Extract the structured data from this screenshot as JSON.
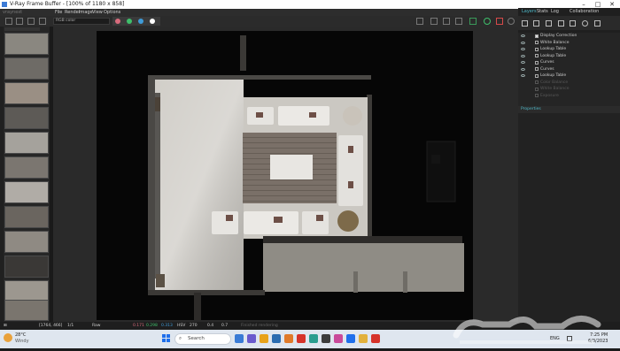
{
  "window": {
    "title": "V-Ray Frame Buffer - [100% of 1180 x 858]",
    "controls": [
      "–",
      "□",
      "✕"
    ]
  },
  "menubar": {
    "brand": "vraynext",
    "items": [
      "File",
      "Render",
      "Image",
      "View",
      "Options"
    ]
  },
  "toolbar": {
    "channel_value": "RGB color",
    "channel_dots": [
      "#d86b7c",
      "#3fbf6b",
      "#3f9bd8",
      "#ffffff"
    ]
  },
  "right_panel": {
    "tabs": [
      "Layers",
      "Stats",
      "Log",
      "Collaboration"
    ],
    "active_tab": "Layers",
    "accent": "#4fb8c8",
    "layers": [
      {
        "label": "Display Correction",
        "visible": true,
        "checked": true
      },
      {
        "label": "White Balance",
        "visible": true
      },
      {
        "label": "Lookup Table",
        "visible": true
      },
      {
        "label": "Lookup Table",
        "visible": true
      },
      {
        "label": "Curves",
        "visible": true
      },
      {
        "label": "Curves",
        "visible": true
      },
      {
        "label": "Lookup Table",
        "visible": true
      },
      {
        "label": "Color Balance",
        "visible": false
      },
      {
        "label": "White Balance",
        "visible": false
      },
      {
        "label": "Exposure",
        "visible": false
      }
    ],
    "properties_title": "Properties"
  },
  "statusbar": {
    "coords": "[1764, 466]",
    "zoom": "1/1",
    "channel": "Raw",
    "values": [
      "0.171",
      "0.298",
      "0.313"
    ],
    "mode": "HSV",
    "extra": [
      "270",
      "0.4",
      "0.7"
    ],
    "message": "Finished rendering"
  },
  "taskbar": {
    "weather_temp": "28°C",
    "weather_desc": "Windy",
    "search_label": "Search",
    "lang": "ENG",
    "time": "7:25 PM",
    "date": "6/3/2023",
    "app_colors": [
      "#3a7bd5",
      "#6a5acd",
      "#e8a21a",
      "#2b6cb0",
      "#e07a2a",
      "#d6332a",
      "#2a9d8f",
      "#3d3d3d",
      "#c94a9a",
      "#1f6feb",
      "#e2b13c"
    ]
  },
  "watermark": {
    "text": "حراج"
  },
  "history": {
    "thumbnail_count": 14
  }
}
